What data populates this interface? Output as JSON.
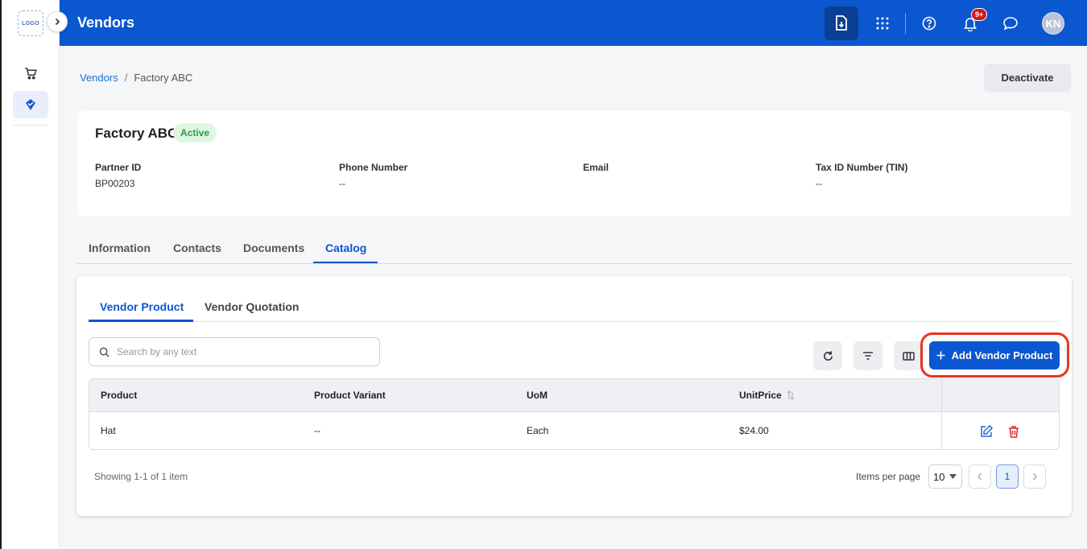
{
  "app": {
    "logo_text": "LOGO",
    "title": "Vendors",
    "user_initials": "KN",
    "notification_count": "9+",
    "accent_color": "#0b57d0"
  },
  "sidebar": {
    "items": [
      {
        "icon": "cart-icon",
        "label": "Orders"
      },
      {
        "icon": "vendor-tag-icon",
        "label": "Vendors",
        "active": true
      }
    ]
  },
  "header_icons": [
    "download-icon",
    "apps-grid-icon",
    "help-icon",
    "bell-icon",
    "chat-icon"
  ],
  "breadcrumb": {
    "parent": "Vendors",
    "separator": "/",
    "current": "Factory ABC"
  },
  "actions": {
    "deactivate_label": "Deactivate"
  },
  "vendor": {
    "name": "Factory ABC",
    "status": "Active",
    "fields": [
      {
        "label": "Partner ID",
        "value": "BP00203"
      },
      {
        "label": "Phone Number",
        "value": "--"
      },
      {
        "label": "Email",
        "value": ""
      },
      {
        "label": "Tax ID Number (TIN)",
        "value": "--"
      }
    ]
  },
  "main_tabs": [
    {
      "label": "Information"
    },
    {
      "label": "Contacts"
    },
    {
      "label": "Documents"
    },
    {
      "label": "Catalog",
      "active": true
    }
  ],
  "sub_tabs": [
    {
      "label": "Vendor Product",
      "active": true
    },
    {
      "label": "Vendor Quotation"
    }
  ],
  "search": {
    "placeholder": "Search by any text",
    "value": ""
  },
  "toolbar": {
    "add_label": "Add Vendor Product"
  },
  "table": {
    "columns": [
      "Product",
      "Product Variant",
      "UoM",
      "UnitPrice"
    ],
    "rows": [
      {
        "product": "Hat",
        "variant": "--",
        "uom": "Each",
        "unit_price": "$24.00"
      }
    ]
  },
  "pagination": {
    "showing_text": "Showing 1-1 of 1 item",
    "items_per_page_label": "Items per page",
    "items_per_page": "10",
    "current_page": "1"
  }
}
